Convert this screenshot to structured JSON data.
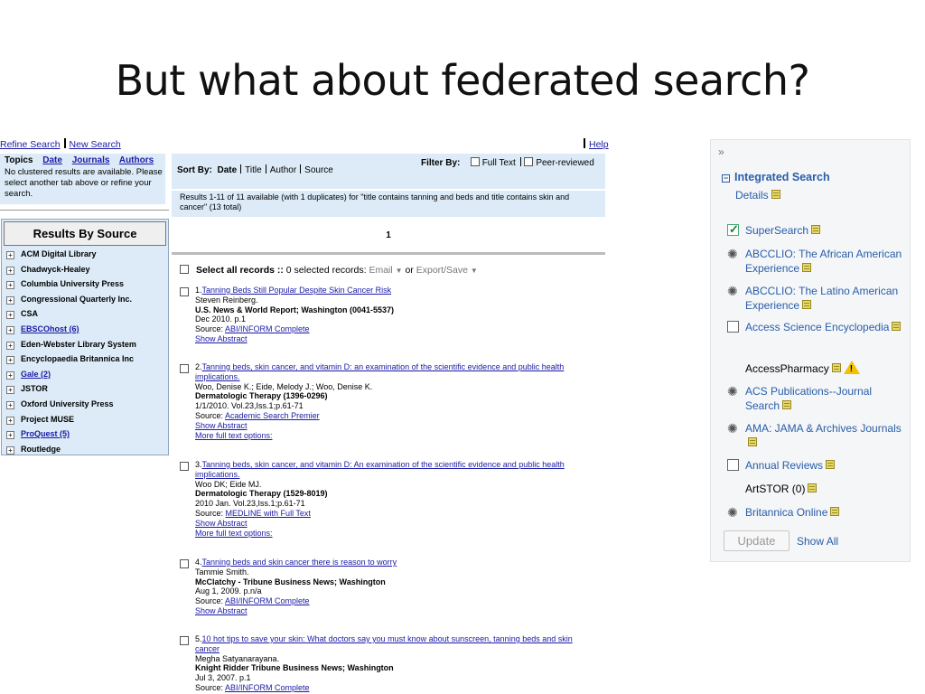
{
  "slide_title": "But what about federated search?",
  "search_ui": {
    "top_links": {
      "refine": "Refine Search",
      "new": "New Search",
      "help": "Help"
    },
    "topics": {
      "tabs": [
        "Topics",
        "Date",
        "Journals",
        "Authors"
      ],
      "message": "No clustered results are available. Please select another tab above or refine your search."
    },
    "results_by_source": {
      "heading": "Results By Source",
      "items": [
        {
          "label": "ACM Digital Library",
          "link": false
        },
        {
          "label": "Chadwyck-Healey",
          "link": false
        },
        {
          "label": "Columbia University Press",
          "link": false
        },
        {
          "label": "Congressional Quarterly Inc.",
          "link": false
        },
        {
          "label": "CSA",
          "link": false
        },
        {
          "label": "EBSCOhost (6)",
          "link": true
        },
        {
          "label": "Eden-Webster Library System",
          "link": false
        },
        {
          "label": "Encyclopaedia Britannica Inc",
          "link": false
        },
        {
          "label": "Gale (2)",
          "link": true
        },
        {
          "label": "JSTOR",
          "link": false
        },
        {
          "label": "Oxford University Press",
          "link": false
        },
        {
          "label": "Project MUSE",
          "link": false
        },
        {
          "label": "ProQuest (5)",
          "link": true
        },
        {
          "label": "Routledge",
          "link": false
        }
      ]
    },
    "sort": {
      "label": "Sort By:",
      "options": [
        "Date",
        "Title",
        "Author",
        "Source"
      ],
      "active": "Date"
    },
    "filter": {
      "label": "Filter By:",
      "options": [
        "Full Text",
        "Peer-reviewed"
      ]
    },
    "summary": "Results 1-11 of 11 available (with 1 duplicates) for \"title contains tanning and beds and title contains skin and cancer\" (13 total)",
    "page": "1",
    "select_all": {
      "label": "Select all records ::",
      "count_text": "0 selected records:",
      "email": "Email",
      "or": "or",
      "export": "Export/Save"
    },
    "results": [
      {
        "num": "1.",
        "title": "Tanning Beds Still Popular Despite Skin Cancer Risk",
        "authors": "Steven Reinberg.",
        "source_title": "U.S. News & World Report; Washington (0041-5537)",
        "date": "Dec 2010. p.1",
        "source_label": "Source:",
        "source_link": "ABI/INFORM Complete",
        "actions": [
          "Show Abstract"
        ]
      },
      {
        "num": "2.",
        "title": "Tanning beds, skin cancer, and vitamin D: an examination of the scientific evidence and public health implications.",
        "authors": "Woo, Denise K.; Eide, Melody J.; Woo, Denise K.",
        "source_title": "Dermatologic Therapy (1396-0296)",
        "date": "1/1/2010. Vol.23,Iss.1;p.61-71",
        "source_label": "Source:",
        "source_link": "Academic Search Premier",
        "actions": [
          "Show Abstract",
          "More full text options:"
        ]
      },
      {
        "num": "3.",
        "title": "Tanning beds, skin cancer, and vitamin D: An examination of the scientific evidence and public health implications.",
        "authors": "Woo DK; Eide MJ.",
        "source_title": "Dermatologic Therapy (1529-8019)",
        "date": "2010 Jan. Vol.23,Iss.1;p.61-71",
        "source_label": "Source:",
        "source_link": "MEDLINE with Full Text",
        "actions": [
          "Show Abstract",
          "More full text options:"
        ]
      },
      {
        "num": "4.",
        "title": "Tanning beds and skin cancer there is reason to worry",
        "authors": "Tammie Smith.",
        "source_title": "McClatchy - Tribune Business News; Washington",
        "date": "Aug 1, 2009. p.n/a",
        "source_label": "Source:",
        "source_link": "ABI/INFORM Complete",
        "actions": [
          "Show Abstract"
        ]
      },
      {
        "num": "5.",
        "title": "10 hot tips to save your skin: What doctors say you must know about sunscreen, tanning beds and skin cancer",
        "authors": "Megha Satyanarayana.",
        "source_title": "Knight Ridder Tribune Business News; Washington",
        "date": "Jul 3, 2007. p.1",
        "source_label": "Source:",
        "source_link": "ABI/INFORM Complete",
        "actions": []
      }
    ]
  },
  "integrated_panel": {
    "collapse_glyph": "»",
    "heading": "Integrated Search",
    "heading_box": "−",
    "details": "Details",
    "items": [
      {
        "label": "SuperSearch",
        "indicator": "checkbox-checked",
        "link": true,
        "warning": false
      },
      {
        "label": "ABCCLIO: The African American Experience",
        "indicator": "spinner",
        "link": true,
        "warning": false
      },
      {
        "label": "ABCCLIO: The Latino American Experience",
        "indicator": "spinner",
        "link": true,
        "warning": false
      },
      {
        "label": "Access Science Encyclopedia",
        "indicator": "checkbox",
        "link": true,
        "warning": false
      },
      {
        "label": "AccessPharmacy",
        "indicator": "none",
        "link": false,
        "warning": true
      },
      {
        "label": "ACS Publications--Journal Search",
        "indicator": "spinner",
        "link": true,
        "warning": false
      },
      {
        "label": "AMA: JAMA & Archives Journals",
        "indicator": "spinner",
        "link": true,
        "warning": false
      },
      {
        "label": "Annual Reviews",
        "indicator": "checkbox",
        "link": true,
        "warning": false
      },
      {
        "label": "ArtSTOR (0)",
        "indicator": "none",
        "link": false,
        "warning": false
      },
      {
        "label": "Britannica Online",
        "indicator": "spinner",
        "link": true,
        "warning": false
      }
    ],
    "update_button": "Update",
    "show_all": "Show All",
    "colors": {
      "link": "#2a5da8",
      "panel_bg": "#f4f6f8",
      "warning": "#f2c200"
    }
  }
}
